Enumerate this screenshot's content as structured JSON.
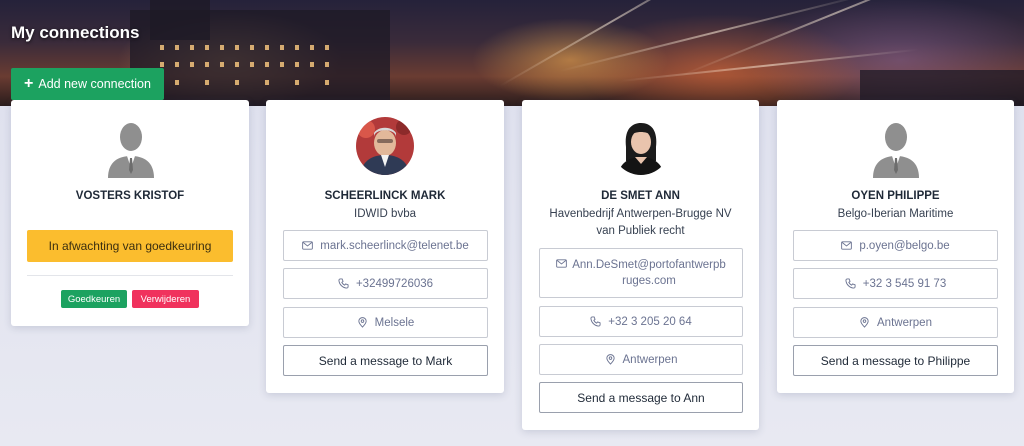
{
  "page": {
    "title": "My connections"
  },
  "toolbar": {
    "add_label": "Add new connection"
  },
  "colors": {
    "primary_green": "#1ca260",
    "pending_yellow": "#fbbd2e",
    "delete_red": "#f0325d"
  },
  "cards": [
    {
      "name": "VOSTERS KRISTOF",
      "status": "In afwachting van goedkeuring",
      "approve_label": "Goedkeuren",
      "delete_label": "Verwijderen",
      "avatar": "person-silhouette-icon"
    },
    {
      "name": "SCHEERLINCK MARK",
      "company": "IDWID bvba",
      "email": "mark.scheerlinck@telenet.be",
      "phone": "+32499726036",
      "location": "Melsele",
      "message_label": "Send a message to Mark",
      "avatar": "photo"
    },
    {
      "name": "DE SMET ANN",
      "company_line1": "Havenbedrijf Antwerpen-Brugge NV",
      "company_line2": "van Publiek recht",
      "email_line1": "Ann.DeSmet@portofantwerpb",
      "email_line2": "ruges.com",
      "phone": "+32 3 205 20 64",
      "location": "Antwerpen",
      "message_label": "Send a message to Ann",
      "avatar": "photo"
    },
    {
      "name": "OYEN PHILIPPE",
      "company": "Belgo-Iberian Maritime",
      "email": "p.oyen@belgo.be",
      "phone": "+32 3 545 91 73",
      "location": "Antwerpen",
      "message_label": "Send a message to Philippe",
      "avatar": "person-silhouette-icon"
    }
  ]
}
